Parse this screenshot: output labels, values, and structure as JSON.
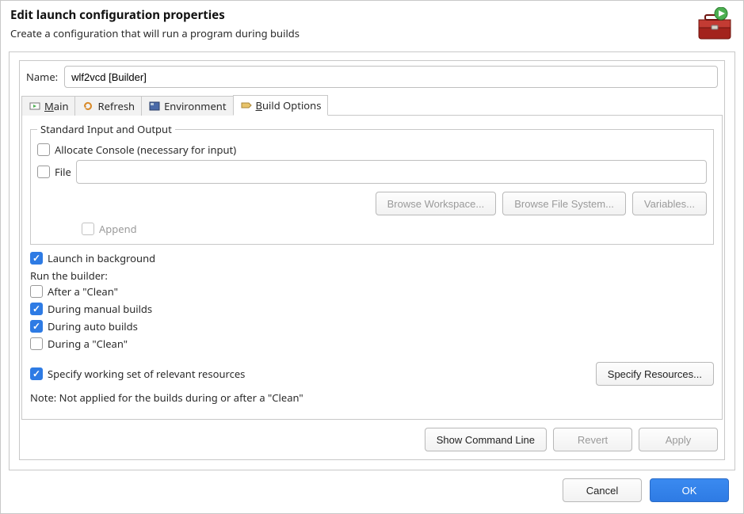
{
  "header": {
    "title": "Edit launch configuration properties",
    "subtitle": "Create a configuration that will run a program during builds"
  },
  "nameRow": {
    "label": "Name:",
    "value": "wlf2vcd [Builder]"
  },
  "tabs": [
    {
      "label": "Main",
      "underline": "M"
    },
    {
      "label": "Refresh",
      "underline": ""
    },
    {
      "label": "Environment",
      "underline": ""
    },
    {
      "label": "Build Options",
      "underline": "B",
      "active": true
    }
  ],
  "stdio": {
    "legend": "Standard Input and Output",
    "allocateConsole": "Allocate Console (necessary for input)",
    "fileLabel": "File",
    "browseWorkspace": "Browse Workspace...",
    "browseFS": "Browse File System...",
    "variables": "Variables...",
    "append": "Append"
  },
  "opts": {
    "launchBg": "Launch in background",
    "runBuilderLabel": "Run the builder:",
    "afterClean": "After a \"Clean\"",
    "duringManual": "During manual builds",
    "duringAuto": "During auto builds",
    "duringClean": "During a \"Clean\"",
    "specifyWS": "Specify working set of relevant resources",
    "specifyResourcesBtn": "Specify Resources...",
    "note": "Note: Not applied for the builds during or after a \"Clean\""
  },
  "lower": {
    "showCmd": "Show Command Line",
    "revert": "Revert",
    "apply": "Apply"
  },
  "footer": {
    "cancel": "Cancel",
    "ok": "OK"
  }
}
